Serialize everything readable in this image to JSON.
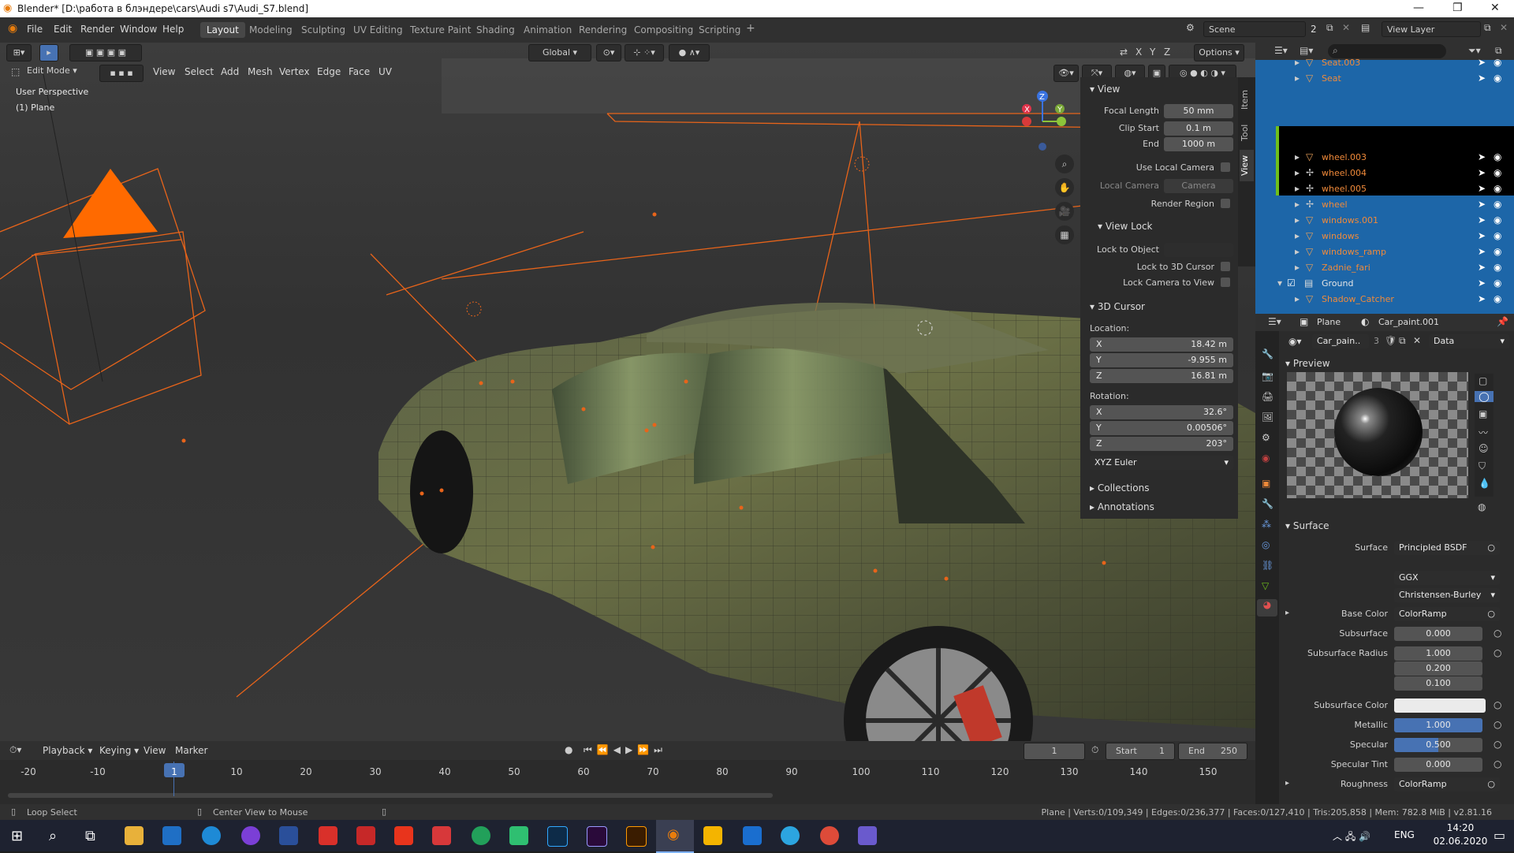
{
  "window": {
    "title": "Blender* [D:\\работа в блэндере\\cars\\Audi s7\\Audi_S7.blend]"
  },
  "menu": [
    "File",
    "Edit",
    "Render",
    "Window",
    "Help"
  ],
  "workspaces": [
    "Layout",
    "Modeling",
    "Sculpting",
    "UV Editing",
    "Texture Paint",
    "Shading",
    "Animation",
    "Rendering",
    "Compositing",
    "Scripting"
  ],
  "scene": {
    "label": "Scene",
    "count": "2"
  },
  "view_layer": {
    "label": "View Layer"
  },
  "viewport_header": {
    "mode": "Edit Mode",
    "menus": [
      "View",
      "Select",
      "Add",
      "Mesh",
      "Vertex",
      "Edge",
      "Face",
      "UV"
    ],
    "transform_orientation": "Global",
    "axes": [
      "X",
      "Y",
      "Z"
    ],
    "options": "Options"
  },
  "overlay_text": {
    "perspective": "User Perspective",
    "object": "(1) Plane"
  },
  "npanel": {
    "tabs": [
      "Item",
      "Tool",
      "View"
    ],
    "view": {
      "title": "View",
      "focal_length_label": "Focal Length",
      "focal_length": "50 mm",
      "clip_start_label": "Clip Start",
      "clip_start": "0.1 m",
      "end_label": "End",
      "end": "1000 m",
      "use_local_camera": "Use Local Camera",
      "local_camera_label": "Local Camera",
      "local_camera": "Camera",
      "render_region": "Render Region"
    },
    "view_lock": {
      "title": "View Lock",
      "lock_to_object": "Lock to Object",
      "lock_to_cursor": "Lock to 3D Cursor",
      "lock_camera": "Lock Camera to View"
    },
    "cursor": {
      "title": "3D Cursor",
      "location_label": "Location:",
      "loc": [
        {
          "axis": "X",
          "value": "18.42 m"
        },
        {
          "axis": "Y",
          "value": "-9.955 m"
        },
        {
          "axis": "Z",
          "value": "16.81 m"
        }
      ],
      "rotation_label": "Rotation:",
      "rot": [
        {
          "axis": "X",
          "value": "32.6°"
        },
        {
          "axis": "Y",
          "value": "0.00506°"
        },
        {
          "axis": "Z",
          "value": "203°"
        }
      ],
      "rotation_mode": "XYZ Euler"
    },
    "collections": "Collections",
    "annotations": "Annotations"
  },
  "outliner": {
    "rows": [
      {
        "name": "Seat.003"
      },
      {
        "name": "Seat"
      },
      {
        "name": "wheel.003"
      },
      {
        "name": "wheel.004"
      },
      {
        "name": "wheel.005"
      },
      {
        "name": "wheel"
      },
      {
        "name": "windows.001"
      },
      {
        "name": "windows"
      },
      {
        "name": "windows_ramp"
      },
      {
        "name": "Zadnie_fari"
      }
    ],
    "collection": "Ground",
    "shadow": "Shadow_Catcher"
  },
  "properties": {
    "object": "Plane",
    "material": "Car_paint.001",
    "slot": "Car_pain..",
    "users": "3",
    "link": "Data",
    "preview_title": "Preview",
    "surface_title": "Surface",
    "rows": [
      {
        "label": "Surface",
        "value": "Principled BSDF"
      },
      {
        "label": "",
        "value": "GGX"
      },
      {
        "label": "",
        "value": "Christensen-Burley"
      },
      {
        "label": "Base Color",
        "value": "ColorRamp"
      },
      {
        "label": "Subsurface",
        "value": "0.000"
      },
      {
        "label": "Subsurface Radius",
        "value": "1.000"
      },
      {
        "label": "",
        "value": "0.200"
      },
      {
        "label": "",
        "value": "0.100"
      },
      {
        "label": "Subsurface Color",
        "value": ""
      },
      {
        "label": "Metallic",
        "value": "1.000",
        "fill": 1.0
      },
      {
        "label": "Specular",
        "value": "0.500",
        "fill": 0.5
      },
      {
        "label": "Specular Tint",
        "value": "0.000"
      },
      {
        "label": "Roughness",
        "value": "ColorRamp"
      }
    ]
  },
  "timeline": {
    "menus": [
      "Playback",
      "Keying",
      "View",
      "Marker"
    ],
    "current_frame": "1",
    "start_label": "Start",
    "start": "1",
    "end_label": "End",
    "end": "250",
    "ticks": [
      "-20",
      "-10",
      "1",
      "10",
      "20",
      "30",
      "40",
      "50",
      "60",
      "70",
      "80",
      "90",
      "100",
      "110",
      "120",
      "130",
      "140",
      "150"
    ]
  },
  "status": {
    "left": "Loop Select",
    "mid": "Center View to Mouse",
    "right": "Plane | Verts:0/109,349 | Edges:0/236,377 | Faces:0/127,410 | Tris:205,858 | Mem: 782.8 MiB | v2.81.16"
  },
  "taskbar": {
    "lang": "ENG",
    "time": "14:20",
    "date": "02.06.2020"
  },
  "colors": {
    "accent": "#4772b3",
    "outliner_sel": "#1d66a8",
    "orange": "#ff6a00"
  }
}
